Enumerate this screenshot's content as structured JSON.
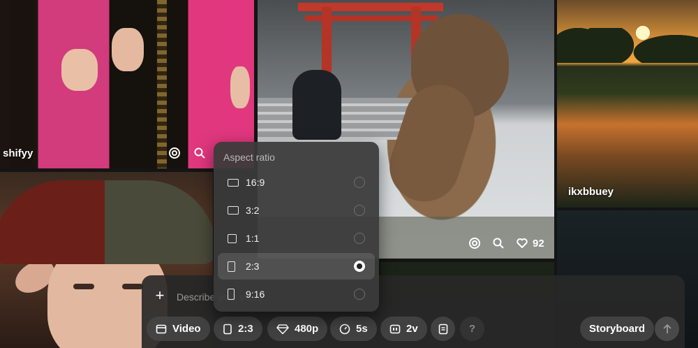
{
  "gallery": {
    "tile1": {
      "author": "shifyy"
    },
    "tile2": {
      "likes": "92"
    },
    "tile3": {
      "author": "ikxbbuey"
    }
  },
  "aspect_menu": {
    "header": "Aspect ratio",
    "options": [
      {
        "label": "16:9",
        "selected": false
      },
      {
        "label": "3:2",
        "selected": false
      },
      {
        "label": "1:1",
        "selected": false
      },
      {
        "label": "2:3",
        "selected": true
      },
      {
        "label": "9:16",
        "selected": false
      }
    ]
  },
  "composer": {
    "placeholder": "Describe your video",
    "toolbar": {
      "mode": "Video",
      "aspect": "2:3",
      "quality": "480p",
      "duration": "5s",
      "variations": "2v",
      "help": "?",
      "storyboard": "Storyboard"
    }
  },
  "colors": {
    "selected_radio": "#ffffff",
    "menu_bg": "#3a3a3a",
    "chip_bg": "#464646"
  }
}
